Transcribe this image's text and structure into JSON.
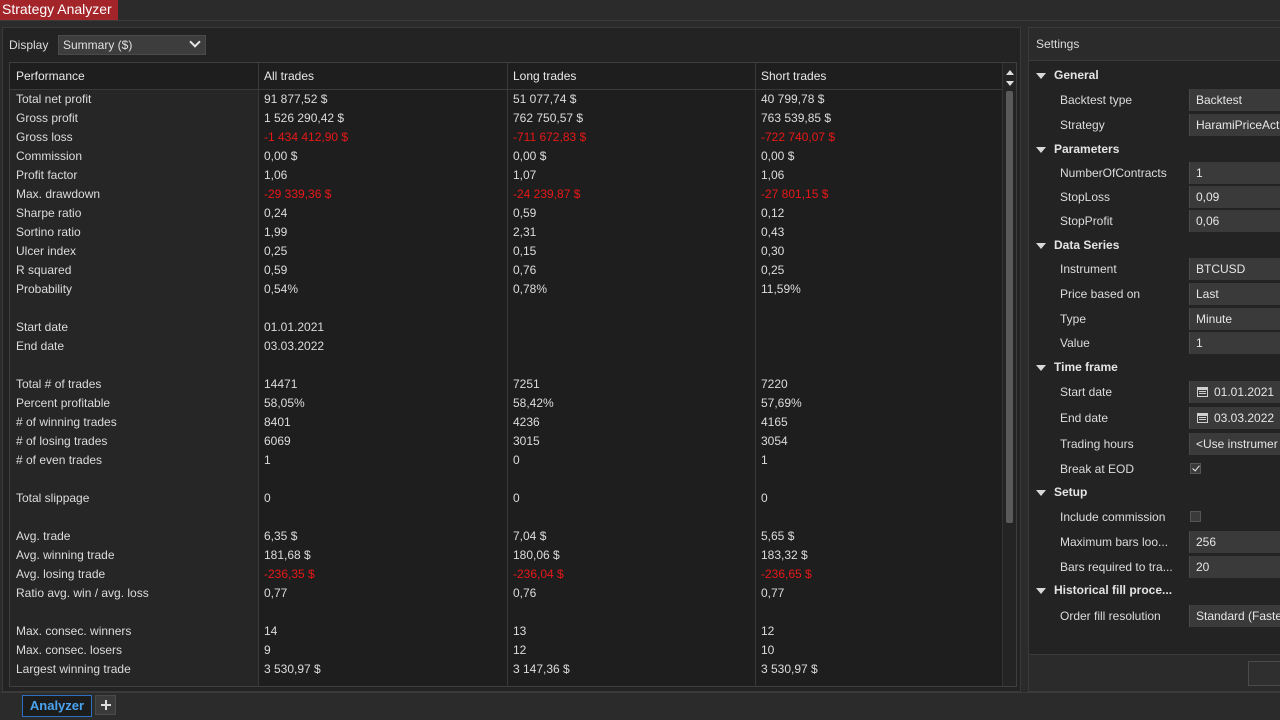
{
  "app": {
    "title": "Strategy Analyzer"
  },
  "display": {
    "label": "Display",
    "selected": "Summary ($)"
  },
  "table": {
    "headers": [
      "Performance",
      "All trades",
      "Long trades",
      "Short trades"
    ],
    "rows": [
      {
        "label": "Total net profit",
        "all": "91 877,52 $",
        "long": "51 077,74 $",
        "short": "40 799,78 $",
        "neg": false
      },
      {
        "label": "Gross profit",
        "all": "1 526 290,42 $",
        "long": "762 750,57 $",
        "short": "763 539,85 $",
        "neg": false
      },
      {
        "label": "Gross loss",
        "all": "-1 434 412,90 $",
        "long": "-711 672,83 $",
        "short": "-722 740,07 $",
        "neg": true
      },
      {
        "label": "Commission",
        "all": "0,00 $",
        "long": "0,00 $",
        "short": "0,00 $",
        "neg": false
      },
      {
        "label": "Profit factor",
        "all": "1,06",
        "long": "1,07",
        "short": "1,06",
        "neg": false
      },
      {
        "label": "Max. drawdown",
        "all": "-29 339,36 $",
        "long": "-24 239,87 $",
        "short": "-27 801,15 $",
        "neg": true
      },
      {
        "label": "Sharpe ratio",
        "all": "0,24",
        "long": "0,59",
        "short": "0,12",
        "neg": false
      },
      {
        "label": "Sortino ratio",
        "all": "1,99",
        "long": "2,31",
        "short": "0,43",
        "neg": false
      },
      {
        "label": "Ulcer index",
        "all": "0,25",
        "long": "0,15",
        "short": "0,30",
        "neg": false
      },
      {
        "label": "R squared",
        "all": "0,59",
        "long": "0,76",
        "short": "0,25",
        "neg": false
      },
      {
        "label": "Probability",
        "all": "0,54%",
        "long": "0,78%",
        "short": "11,59%",
        "neg": false
      },
      {
        "label": "",
        "all": "",
        "long": "",
        "short": "",
        "neg": false
      },
      {
        "label": "Start date",
        "all": "01.01.2021",
        "long": "",
        "short": "",
        "neg": false
      },
      {
        "label": "End date",
        "all": "03.03.2022",
        "long": "",
        "short": "",
        "neg": false
      },
      {
        "label": "",
        "all": "",
        "long": "",
        "short": "",
        "neg": false
      },
      {
        "label": "Total # of trades",
        "all": "14471",
        "long": "7251",
        "short": "7220",
        "neg": false
      },
      {
        "label": "Percent profitable",
        "all": "58,05%",
        "long": "58,42%",
        "short": "57,69%",
        "neg": false
      },
      {
        "label": "# of winning trades",
        "all": "8401",
        "long": "4236",
        "short": "4165",
        "neg": false
      },
      {
        "label": "# of losing trades",
        "all": "6069",
        "long": "3015",
        "short": "3054",
        "neg": false
      },
      {
        "label": "# of even trades",
        "all": "1",
        "long": "0",
        "short": "1",
        "neg": false
      },
      {
        "label": "",
        "all": "",
        "long": "",
        "short": "",
        "neg": false
      },
      {
        "label": "Total slippage",
        "all": "0",
        "long": "0",
        "short": "0",
        "neg": false
      },
      {
        "label": "",
        "all": "",
        "long": "",
        "short": "",
        "neg": false
      },
      {
        "label": "Avg. trade",
        "all": "6,35 $",
        "long": "7,04 $",
        "short": "5,65 $",
        "neg": false
      },
      {
        "label": "Avg. winning trade",
        "all": "181,68 $",
        "long": "180,06 $",
        "short": "183,32 $",
        "neg": false
      },
      {
        "label": "Avg. losing trade",
        "all": "-236,35 $",
        "long": "-236,04 $",
        "short": "-236,65 $",
        "neg": true
      },
      {
        "label": "Ratio avg. win / avg. loss",
        "all": "0,77",
        "long": "0,76",
        "short": "0,77",
        "neg": false
      },
      {
        "label": "",
        "all": "",
        "long": "",
        "short": "",
        "neg": false
      },
      {
        "label": "Max. consec. winners",
        "all": "14",
        "long": "13",
        "short": "12",
        "neg": false
      },
      {
        "label": "Max. consec. losers",
        "all": "9",
        "long": "12",
        "short": "10",
        "neg": false
      },
      {
        "label": "Largest winning trade",
        "all": "3 530,97 $",
        "long": "3 147,36 $",
        "short": "3 530,97 $",
        "neg": false
      }
    ]
  },
  "settings": {
    "title": "Settings",
    "general": {
      "title": "General",
      "backtest_type_label": "Backtest type",
      "backtest_type": "Backtest",
      "strategy_label": "Strategy",
      "strategy": "HaramiPriceAct"
    },
    "parameters": {
      "title": "Parameters",
      "contracts_label": "NumberOfContracts",
      "contracts": "1",
      "stoploss_label": "StopLoss",
      "stoploss": "0,09",
      "stopprofit_label": "StopProfit",
      "stopprofit": "0,06"
    },
    "data_series": {
      "title": "Data Series",
      "instrument_label": "Instrument",
      "instrument": "BTCUSD",
      "price_label": "Price based on",
      "price": "Last",
      "type_label": "Type",
      "type": "Minute",
      "value_label": "Value",
      "value": "1"
    },
    "time_frame": {
      "title": "Time frame",
      "start_label": "Start date",
      "start": "01.01.2021",
      "end_label": "End date",
      "end": "03.03.2022",
      "hours_label": "Trading hours",
      "hours": "<Use instrumer",
      "eod_label": "Break at EOD",
      "eod": true
    },
    "setup": {
      "title": "Setup",
      "commission_label": "Include commission",
      "commission": false,
      "maxbars_label": "Maximum bars loo...",
      "maxbars": "256",
      "barsreq_label": "Bars required to tra...",
      "barsreq": "20"
    },
    "historical": {
      "title": "Historical fill proce...",
      "fill_label": "Order fill resolution",
      "fill": "Standard (Faste"
    }
  },
  "bottom_tabs": {
    "active": "Analyzer"
  }
}
